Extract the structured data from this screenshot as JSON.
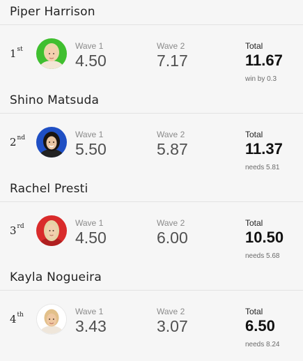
{
  "surfers": [
    {
      "name": "Piper Harrison",
      "place": "1",
      "place_suffix": "st",
      "wave1_label": "Wave 1",
      "wave1": "4.50",
      "wave2_label": "Wave 2",
      "wave2": "7.17",
      "total_label": "Total",
      "total": "11.67",
      "note": "win by 0.3",
      "jersey_color": "#3fbf2f"
    },
    {
      "name": "Shino Matsuda",
      "place": "2",
      "place_suffix": "nd",
      "wave1_label": "Wave 1",
      "wave1": "5.50",
      "wave2_label": "Wave 2",
      "wave2": "5.87",
      "total_label": "Total",
      "total": "11.37",
      "note": "needs 5.81",
      "jersey_color": "#1f4fc4"
    },
    {
      "name": "Rachel Presti",
      "place": "3",
      "place_suffix": "rd",
      "wave1_label": "Wave 1",
      "wave1": "4.50",
      "wave2_label": "Wave 2",
      "wave2": "6.00",
      "total_label": "Total",
      "total": "10.50",
      "note": "needs 5.68",
      "jersey_color": "#d92b2b"
    },
    {
      "name": "Kayla Nogueira",
      "place": "4",
      "place_suffix": "th",
      "wave1_label": "Wave 1",
      "wave1": "3.43",
      "wave2_label": "Wave 2",
      "wave2": "3.07",
      "total_label": "Total",
      "total": "6.50",
      "note": "needs 8.24",
      "jersey_color": "#ffffff"
    }
  ]
}
